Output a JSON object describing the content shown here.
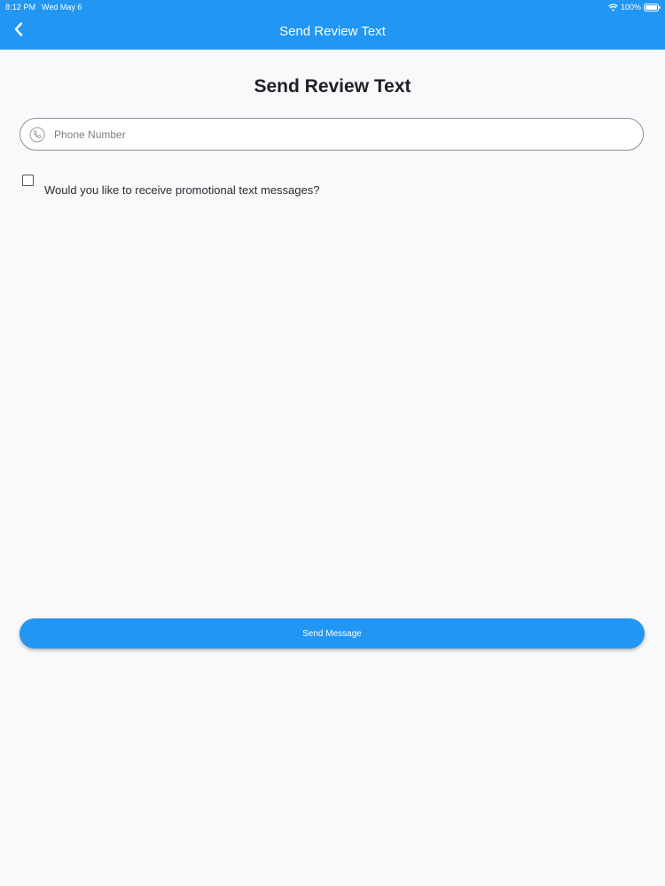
{
  "status_bar": {
    "time": "8:12 PM",
    "date": "Wed May 6",
    "battery": "100%"
  },
  "nav": {
    "title": "Send Review Text",
    "back_icon": "chevron-left-icon"
  },
  "page": {
    "title": "Send Review Text"
  },
  "form": {
    "phone_placeholder": "Phone Number",
    "phone_value": "",
    "phone_icon": "phone-icon",
    "promo_label": "Would you like to receive promotional text messages?",
    "promo_checked": false,
    "send_label": "Send Message"
  },
  "colors": {
    "accent": "#2196f3",
    "background": "#f9f9fb"
  }
}
